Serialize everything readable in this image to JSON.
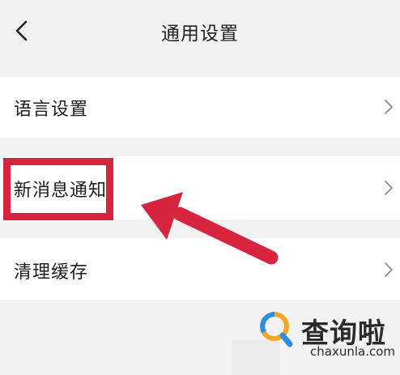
{
  "header": {
    "title": "通用设置"
  },
  "settings": {
    "items": [
      {
        "label": "语言设置"
      },
      {
        "label": "新消息通知"
      },
      {
        "label": "清理缓存"
      }
    ]
  },
  "watermark": {
    "brand_cn": "查询啦",
    "brand_en": "chaxunla.com"
  },
  "colors": {
    "annotation": "#d8253f",
    "background": "#f2f2f2",
    "row": "#ffffff",
    "logo_blue": "#2b8fe0",
    "logo_orange": "#f5a623"
  },
  "icons": {
    "back": "chevron-left-icon",
    "row_arrow": "chevron-right-icon",
    "annotation_arrow": "red-arrow-icon",
    "logo": "magnifier-logo-icon"
  }
}
